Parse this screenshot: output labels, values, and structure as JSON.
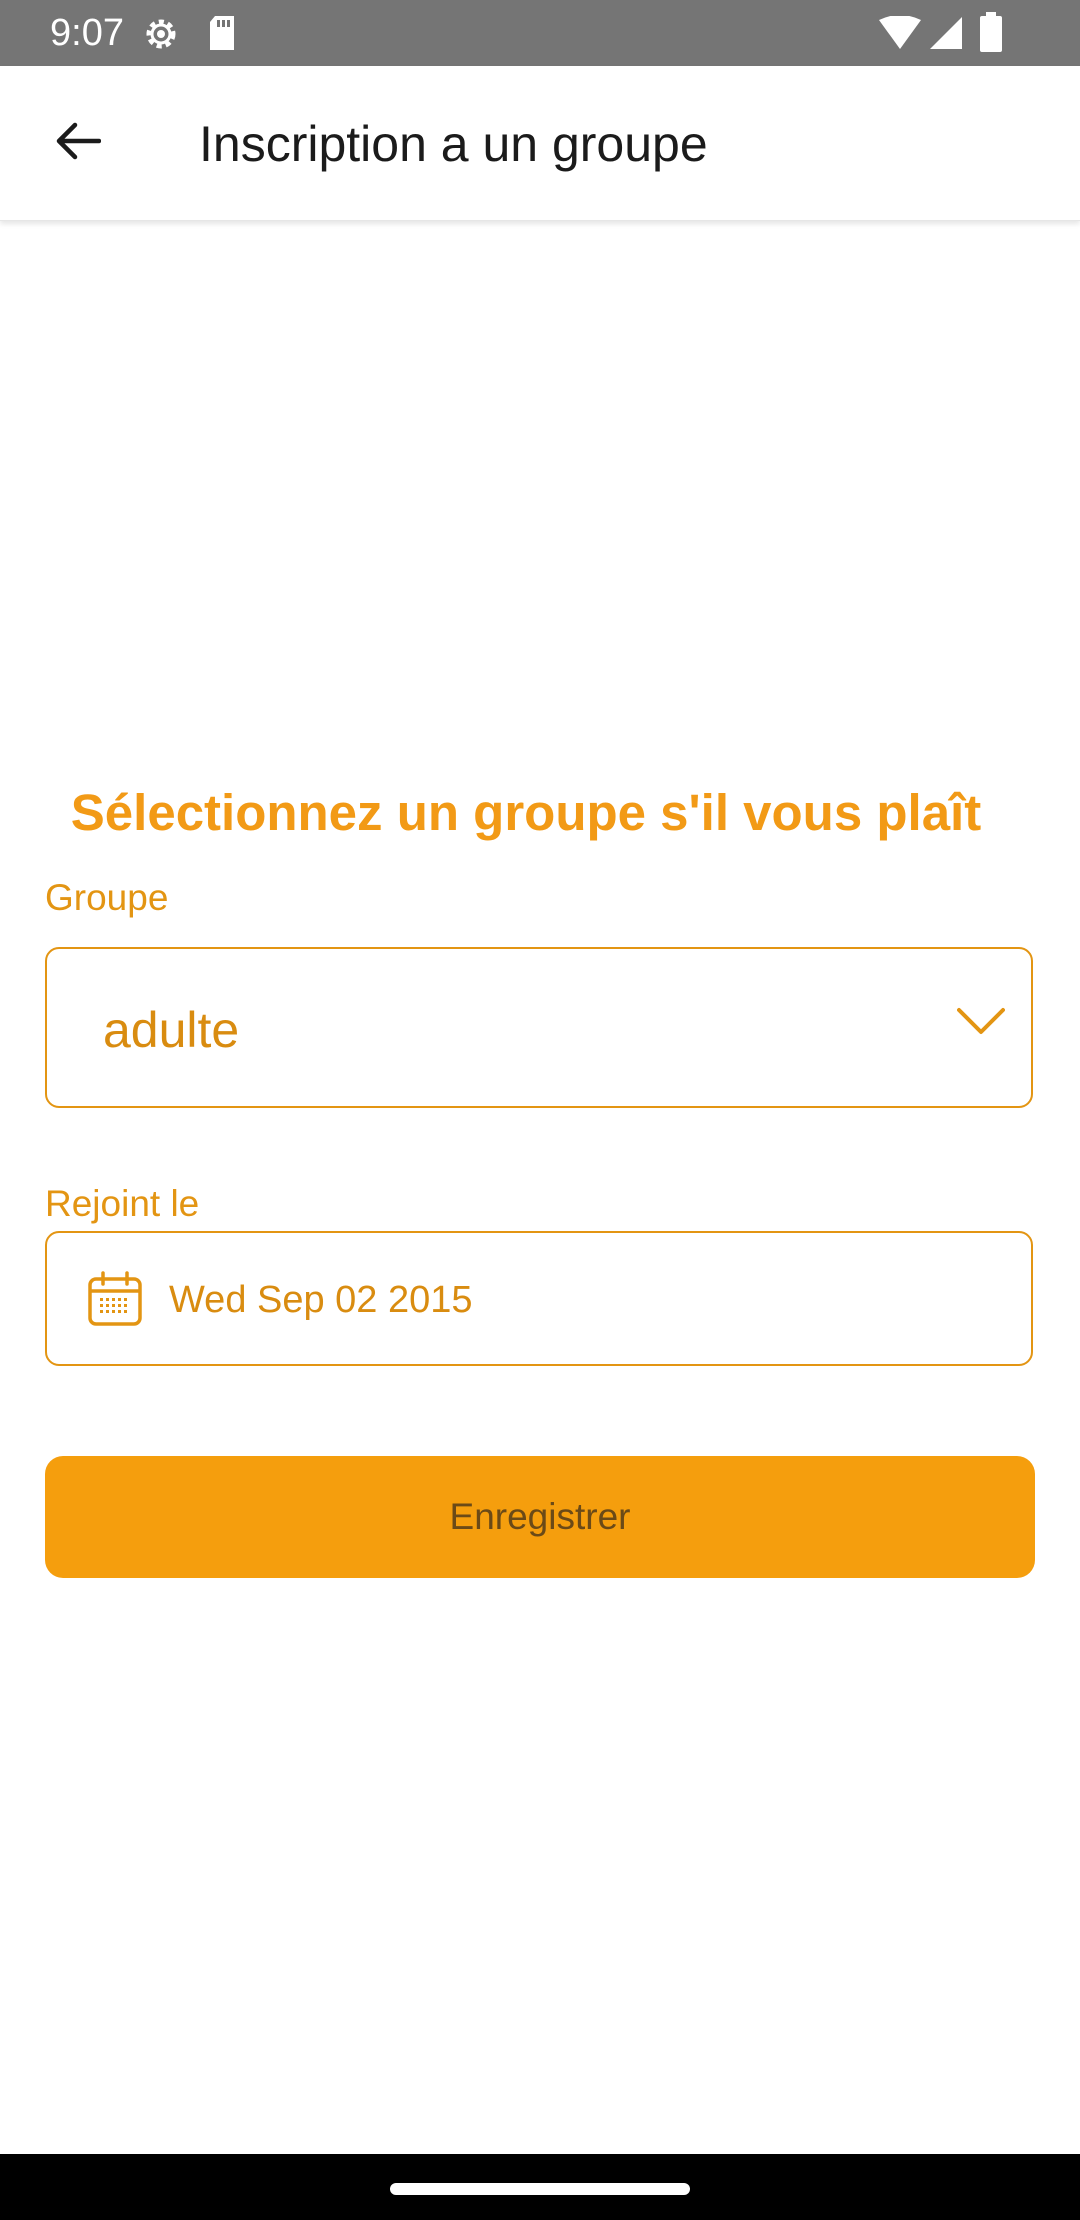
{
  "status_bar": {
    "time": "9:07",
    "icons_left": [
      "settings-gear-icon",
      "sd-card-icon"
    ],
    "icons_right": [
      "wifi-icon",
      "cell-signal-icon",
      "battery-icon"
    ]
  },
  "app_bar": {
    "back_icon": "arrow-back-icon",
    "title": "Inscription a un groupe"
  },
  "form": {
    "heading": "Sélectionnez un groupe s'il vous plaît",
    "group_label": "Groupe",
    "group_value": "adulte",
    "joined_label": "Rejoint le",
    "joined_value": "Wed Sep 02 2015",
    "save_label": "Enregistrer"
  },
  "colors": {
    "accent": "#f29a16",
    "button": "#f59e0d",
    "button_text": "#6b4a17",
    "status_bar": "#757575"
  }
}
